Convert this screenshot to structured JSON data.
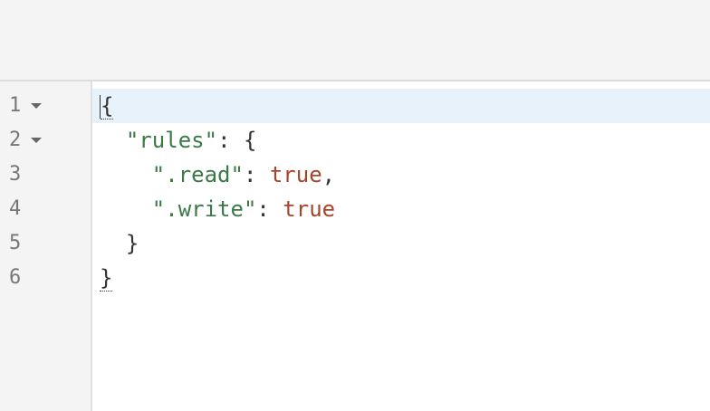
{
  "editor": {
    "gutter": [
      {
        "number": "1",
        "foldable": true
      },
      {
        "number": "2",
        "foldable": true
      },
      {
        "number": "3",
        "foldable": false
      },
      {
        "number": "4",
        "foldable": false
      },
      {
        "number": "5",
        "foldable": false
      },
      {
        "number": "6",
        "foldable": false
      }
    ],
    "lines": [
      {
        "open_brace": "{"
      },
      {
        "indent": "  ",
        "key": "\"rules\"",
        "colon": ": ",
        "brace": "{"
      },
      {
        "indent": "    ",
        "key": "\".read\"",
        "colon": ": ",
        "value": "true",
        "comma": ","
      },
      {
        "indent": "    ",
        "key": "\".write\"",
        "colon": ": ",
        "value": "true"
      },
      {
        "indent": "  ",
        "close_brace": "}"
      },
      {
        "close_brace": "}"
      }
    ],
    "active_line": "1",
    "colors": {
      "key": "#3b7a47",
      "boolean": "#a8442a",
      "active_line_bg": "#e8f2fb",
      "gutter_bg": "#f4f4f4"
    },
    "icons": {
      "fold": "chevron-down-icon"
    }
  }
}
